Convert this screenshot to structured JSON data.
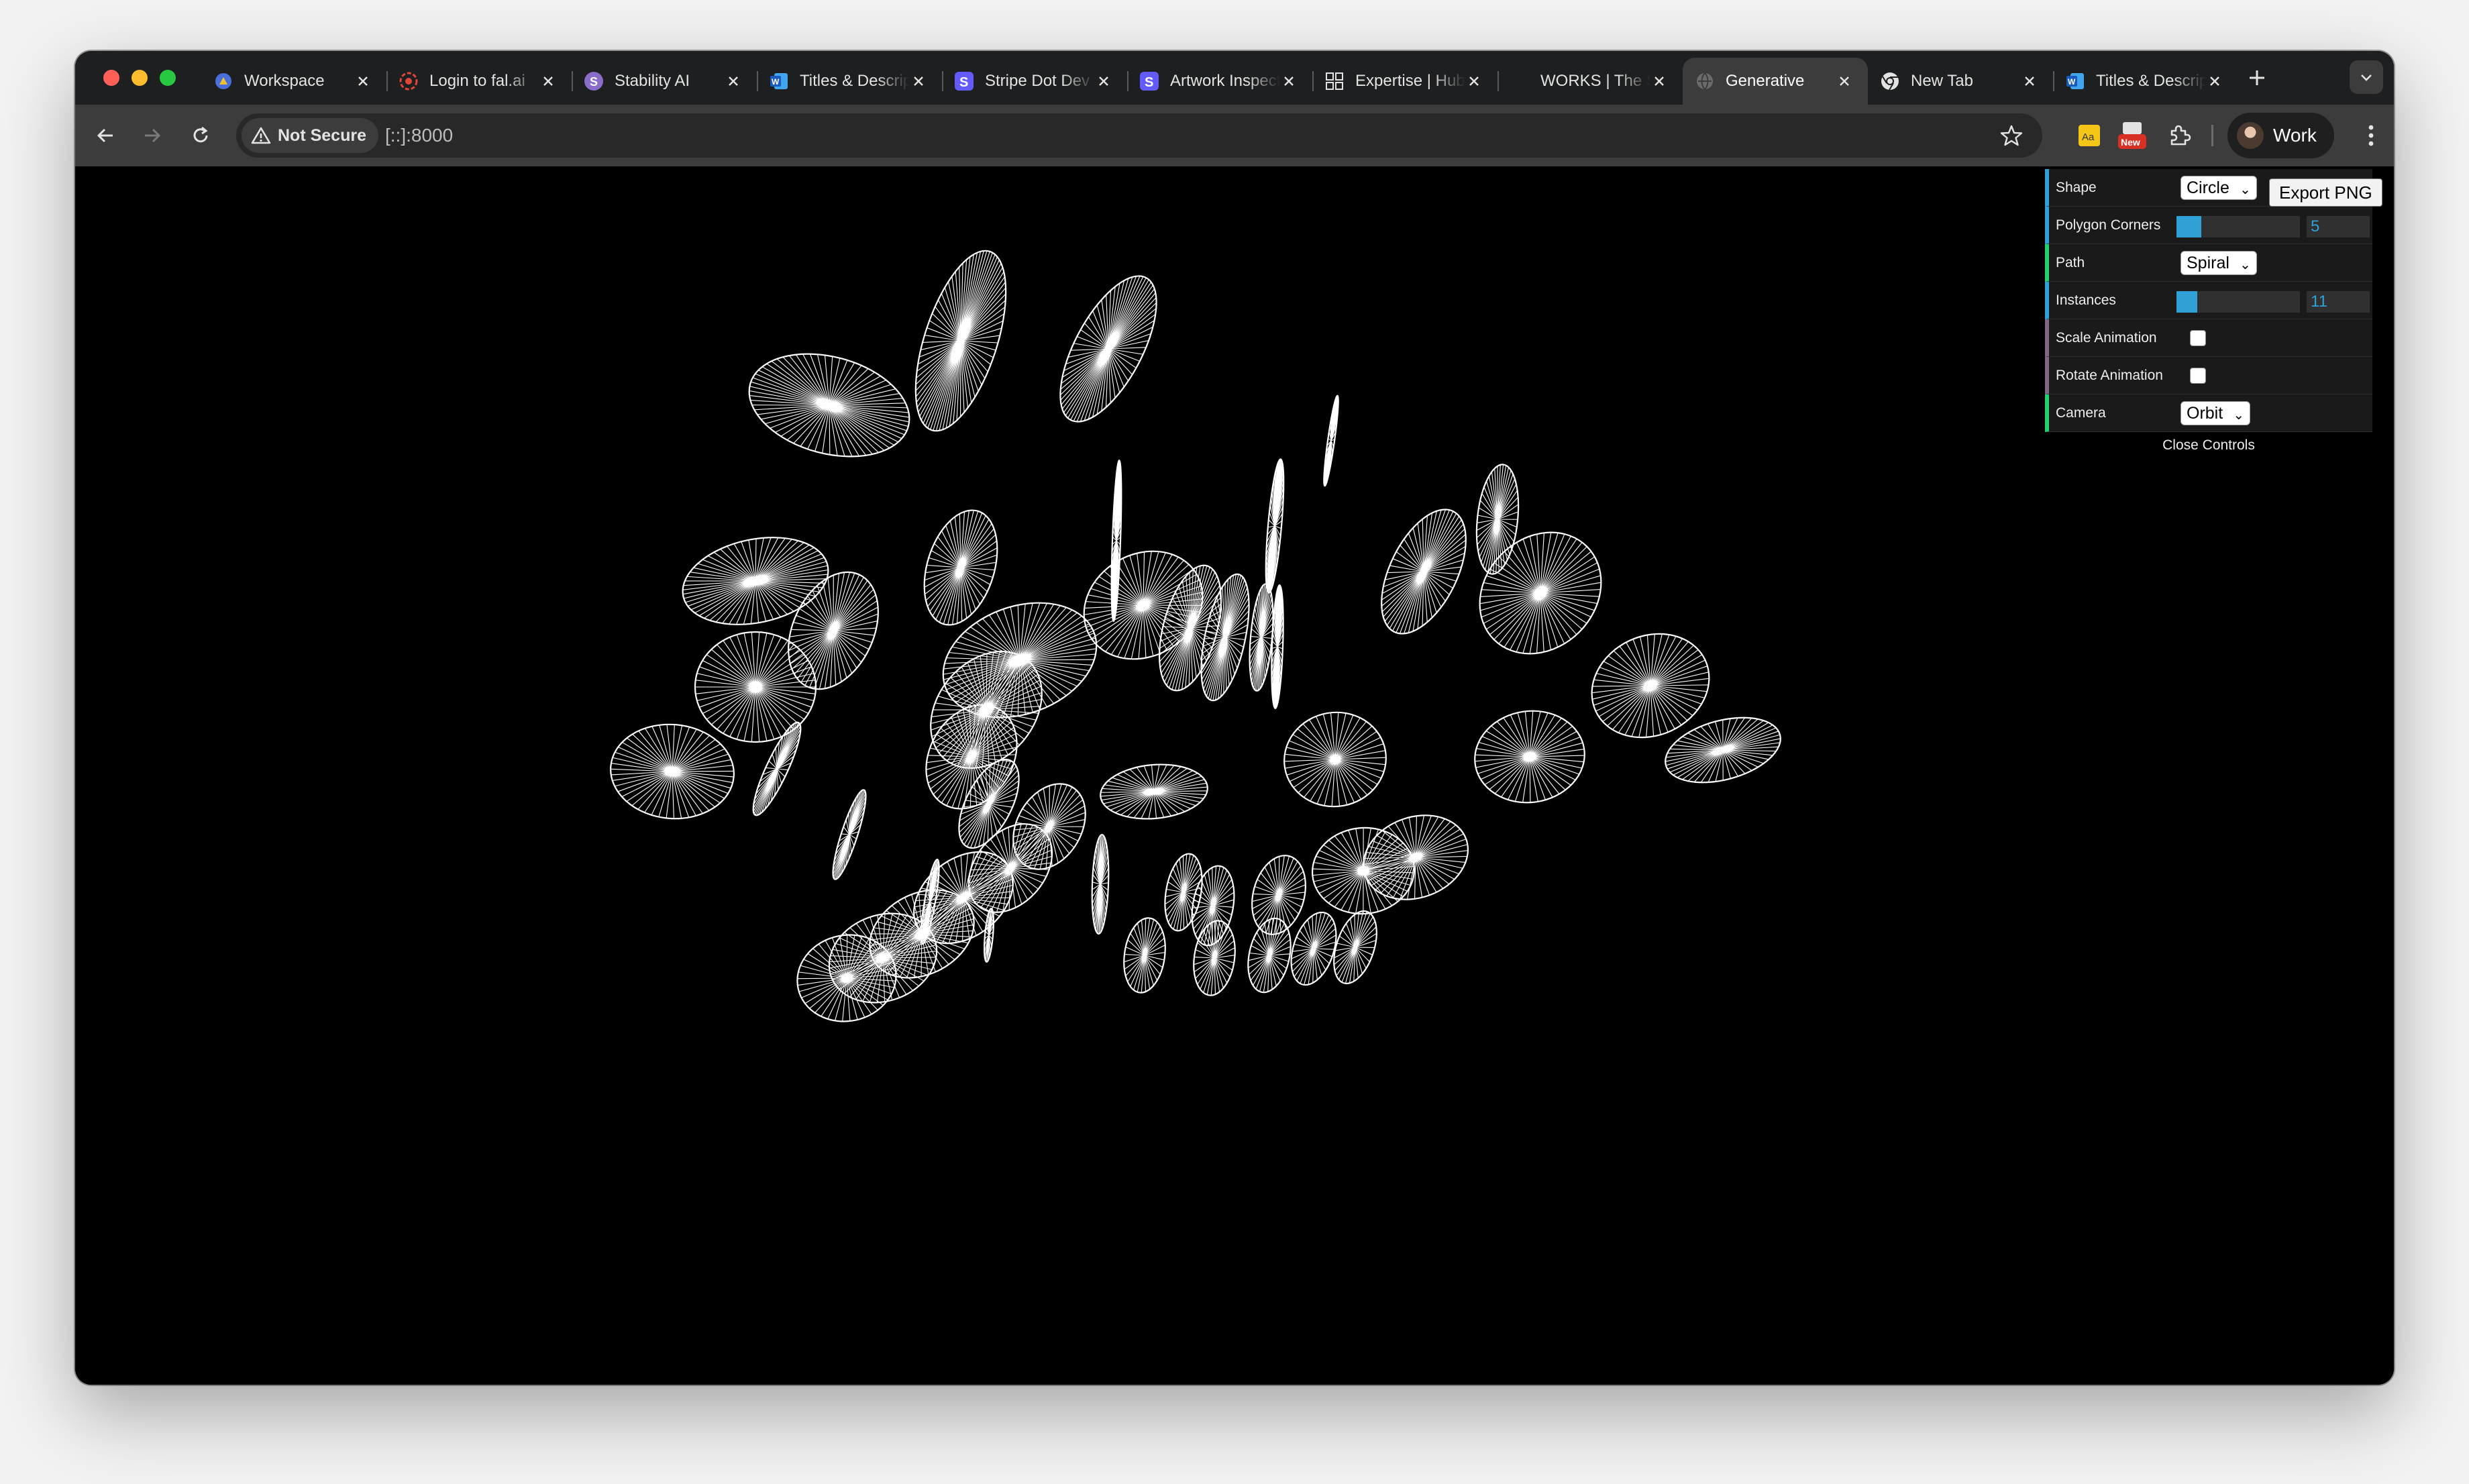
{
  "browser": {
    "tabs": [
      {
        "title": "Workspace",
        "icon": "workspace-icon",
        "active": false
      },
      {
        "title": "Login to fal.ai",
        "icon": "fal-icon",
        "active": false
      },
      {
        "title": "Stability AI",
        "icon": "stability-icon",
        "active": false
      },
      {
        "title": "Titles & Descriptions",
        "icon": "word-icon",
        "active": false
      },
      {
        "title": "Stripe Dot Dev",
        "icon": "stripe-icon",
        "active": false
      },
      {
        "title": "Artwork Inspector",
        "icon": "stripe-icon",
        "active": false
      },
      {
        "title": "Expertise | Hub",
        "icon": "grid-icon",
        "active": false
      },
      {
        "title": "WORKS | The Studio",
        "icon": "blank-icon",
        "active": false
      },
      {
        "title": "Generative",
        "icon": "globe-icon",
        "active": true
      },
      {
        "title": "New Tab",
        "icon": "chrome-icon",
        "active": false
      },
      {
        "title": "Titles & Descriptions",
        "icon": "word-icon",
        "active": false
      }
    ],
    "security_chip": "Not Secure",
    "url": "[::]:8000",
    "extension_badge": "New",
    "dictionary_ext_label": "Aa",
    "profile_name": "Work"
  },
  "gui": {
    "shape_label": "Shape",
    "shape_value": "Circle",
    "polygon_corners_label": "Polygon Corners",
    "polygon_corners_value": "5",
    "path_label": "Path",
    "path_value": "Spiral",
    "instances_label": "Instances",
    "instances_value": "11",
    "scale_animation_label": "Scale Animation",
    "scale_animation_checked": false,
    "rotate_animation_label": "Rotate Animation",
    "rotate_animation_checked": false,
    "camera_label": "Camera",
    "camera_value": "Orbit",
    "close_controls": "Close Controls",
    "export_png": "Export PNG"
  },
  "colors": {
    "traffic_red": "#ff5f57",
    "traffic_yellow": "#febc2e",
    "traffic_green": "#28c840",
    "gui_accent": "#2fa1d6",
    "gui_path_accent": "#1ed36f",
    "gui_bool_accent": "#806787",
    "stroke": "#ffffff",
    "background": "#000000"
  }
}
